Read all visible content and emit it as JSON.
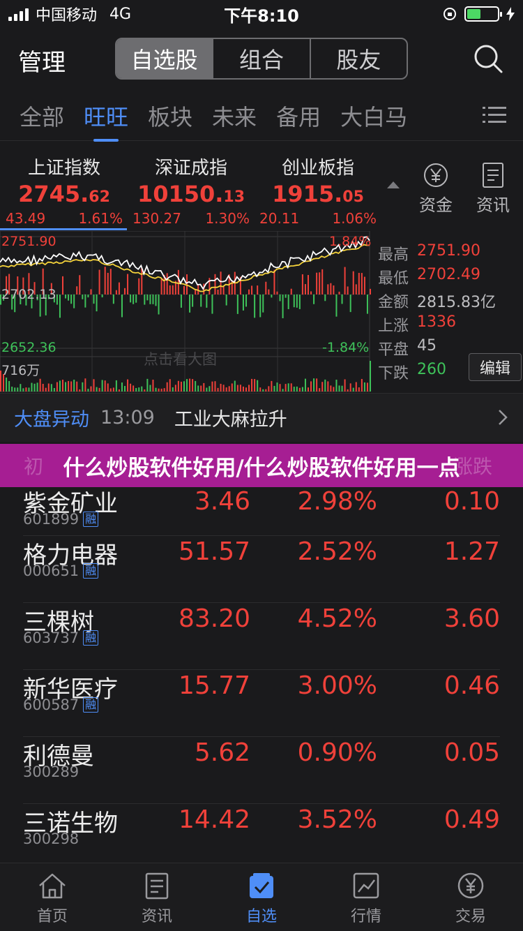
{
  "status_bar": {
    "carrier": "中国移动",
    "network": "4G",
    "time": "下午8:10"
  },
  "header": {
    "title": "管理",
    "segments": [
      "自选股",
      "组合",
      "股友"
    ]
  },
  "categories": [
    "全部",
    "旺旺",
    "板块",
    "未来",
    "备用",
    "大白马"
  ],
  "indices": [
    {
      "name": "上证指数",
      "value_main": "2745.",
      "value_dec": "62",
      "change": "43.49",
      "pct": "1.61%"
    },
    {
      "name": "深证成指",
      "value_main": "10150.",
      "value_dec": "13",
      "change": "130.27",
      "pct": "1.30%"
    },
    {
      "name": "创业板指",
      "value_main": "1915.",
      "value_dec": "05",
      "change": "20.11",
      "pct": "1.06%"
    }
  ],
  "side_buttons": {
    "funds": "资金",
    "news": "资讯"
  },
  "chart": {
    "high_label": "2751.90",
    "mid_label": "2702.13",
    "low_label": "2652.36",
    "high_pct": "1.84%",
    "low_pct": "-1.84%",
    "volume_label": "716万",
    "watermark": "点击看大图",
    "stats": [
      {
        "label": "最高",
        "value": "2751.90",
        "color": "red"
      },
      {
        "label": "最低",
        "value": "2702.49",
        "color": "red"
      },
      {
        "label": "金额",
        "value": "2815.83亿",
        "color": "white"
      },
      {
        "label": "上涨",
        "value": "1336",
        "color": "red"
      },
      {
        "label": "平盘",
        "value": "45",
        "color": "white"
      },
      {
        "label": "下跌",
        "value": "260",
        "color": "green"
      }
    ],
    "edit_label": "编辑"
  },
  "anomaly": {
    "label": "大盘异动",
    "time": "13:09",
    "text": "工业大麻拉升"
  },
  "banner": {
    "text": "什么炒股软件好用/什么炒股软件好用一点",
    "ghost_left": "初",
    "ghost_right": "涨跌"
  },
  "stocks": [
    {
      "name": "紫金矿业",
      "code": "601899",
      "margin": "融",
      "price": "3.46",
      "pct": "2.98%",
      "change": "0.10"
    },
    {
      "name": "格力电器",
      "code": "000651",
      "margin": "融",
      "price": "51.57",
      "pct": "2.52%",
      "change": "1.27"
    },
    {
      "name": "三棵树",
      "code": "603737",
      "margin": "融",
      "price": "83.20",
      "pct": "4.52%",
      "change": "3.60"
    },
    {
      "name": "新华医疗",
      "code": "600587",
      "margin": "融",
      "price": "15.77",
      "pct": "3.00%",
      "change": "0.46"
    },
    {
      "name": "利德曼",
      "code": "300289",
      "margin": "",
      "price": "5.62",
      "pct": "0.90%",
      "change": "0.05"
    },
    {
      "name": "三诺生物",
      "code": "300298",
      "margin": "",
      "price": "14.42",
      "pct": "3.52%",
      "change": "0.49"
    }
  ],
  "tabbar": [
    {
      "label": "首页",
      "icon": "home-icon"
    },
    {
      "label": "资讯",
      "icon": "news-icon"
    },
    {
      "label": "自选",
      "icon": "watchlist-icon",
      "active": true
    },
    {
      "label": "行情",
      "icon": "market-icon"
    },
    {
      "label": "交易",
      "icon": "trade-icon"
    }
  ],
  "colors": {
    "up": "#f0413a",
    "down": "#3ec25a",
    "accent": "#4f8ef7",
    "banner": "#a61e93"
  }
}
